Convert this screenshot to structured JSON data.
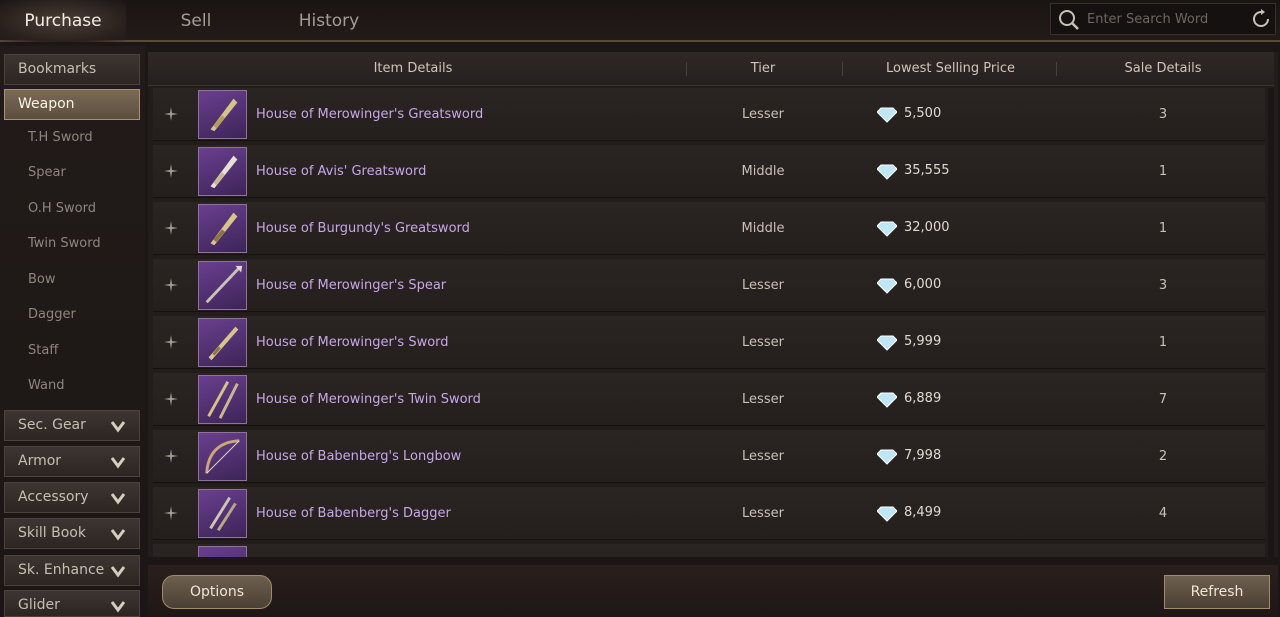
{
  "tabs": [
    {
      "label": "Purchase",
      "active": true
    },
    {
      "label": "Sell",
      "active": false
    },
    {
      "label": "History",
      "active": false
    }
  ],
  "search": {
    "placeholder": "Enter Search Word",
    "value": ""
  },
  "sidebar": {
    "bookmarks": "Bookmarks",
    "weapon": "Weapon",
    "weapon_sub": [
      "T.H Sword",
      "Spear",
      "O.H Sword",
      "Twin Sword",
      "Bow",
      "Dagger",
      "Staff",
      "Wand"
    ],
    "categories": [
      "Sec. Gear",
      "Armor",
      "Accessory",
      "Skill Book",
      "Sk. Enhance",
      "Glider"
    ]
  },
  "table": {
    "headers": {
      "item_details": "Item Details",
      "tier": "Tier",
      "lowest_price": "Lowest Selling Price",
      "sale_details": "Sale Details"
    },
    "rows": [
      {
        "name": "House of Merowinger's Greatsword",
        "tier": "Lesser",
        "price": "5,500",
        "sale": "3"
      },
      {
        "name": "House of Avis' Greatsword",
        "tier": "Middle",
        "price": "35,555",
        "sale": "1"
      },
      {
        "name": "House of Burgundy's Greatsword",
        "tier": "Middle",
        "price": "32,000",
        "sale": "1"
      },
      {
        "name": "House of Merowinger's Spear",
        "tier": "Lesser",
        "price": "6,000",
        "sale": "3"
      },
      {
        "name": "House of Merowinger's Sword",
        "tier": "Lesser",
        "price": "5,999",
        "sale": "1"
      },
      {
        "name": "House of Merowinger's Twin Sword",
        "tier": "Lesser",
        "price": "6,889",
        "sale": "7"
      },
      {
        "name": "House of Babenberg's Longbow",
        "tier": "Lesser",
        "price": "7,998",
        "sale": "2"
      },
      {
        "name": "House of Babenberg's Dagger",
        "tier": "Lesser",
        "price": "8,499",
        "sale": "4"
      }
    ]
  },
  "buttons": {
    "options": "Options",
    "refresh": "Refresh"
  },
  "colors": {
    "accent": "#a8946f",
    "item_name": "#c8a6e8",
    "item_icon_bg": "#5a3478"
  }
}
